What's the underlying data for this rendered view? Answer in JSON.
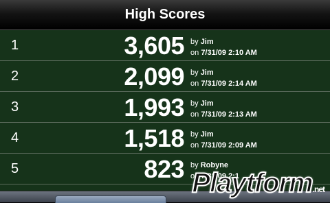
{
  "header": {
    "title": "High Scores"
  },
  "scores": [
    {
      "rank": "1",
      "score": "3,605",
      "by_label": "by",
      "player": "Jim",
      "on_label": "on",
      "date": "7/31/09 2:10 AM"
    },
    {
      "rank": "2",
      "score": "2,099",
      "by_label": "by",
      "player": "Jim",
      "on_label": "on",
      "date": "7/31/09 2:14 AM"
    },
    {
      "rank": "3",
      "score": "1,993",
      "by_label": "by",
      "player": "Jim",
      "on_label": "on",
      "date": "7/31/09 2:13 AM"
    },
    {
      "rank": "4",
      "score": "1,518",
      "by_label": "by",
      "player": "Jim",
      "on_label": "on",
      "date": "7/31/09 2:09 AM"
    },
    {
      "rank": "5",
      "score": "823",
      "by_label": "by",
      "player": "Robyne",
      "on_label": "on",
      "date": "7/31/09 2:1"
    }
  ],
  "watermark": "Playtform",
  "watermark_suffix": ".net",
  "colors": {
    "row_bg": "#16331a",
    "separator": "#5b6b5c",
    "header_bg": "#141414"
  }
}
